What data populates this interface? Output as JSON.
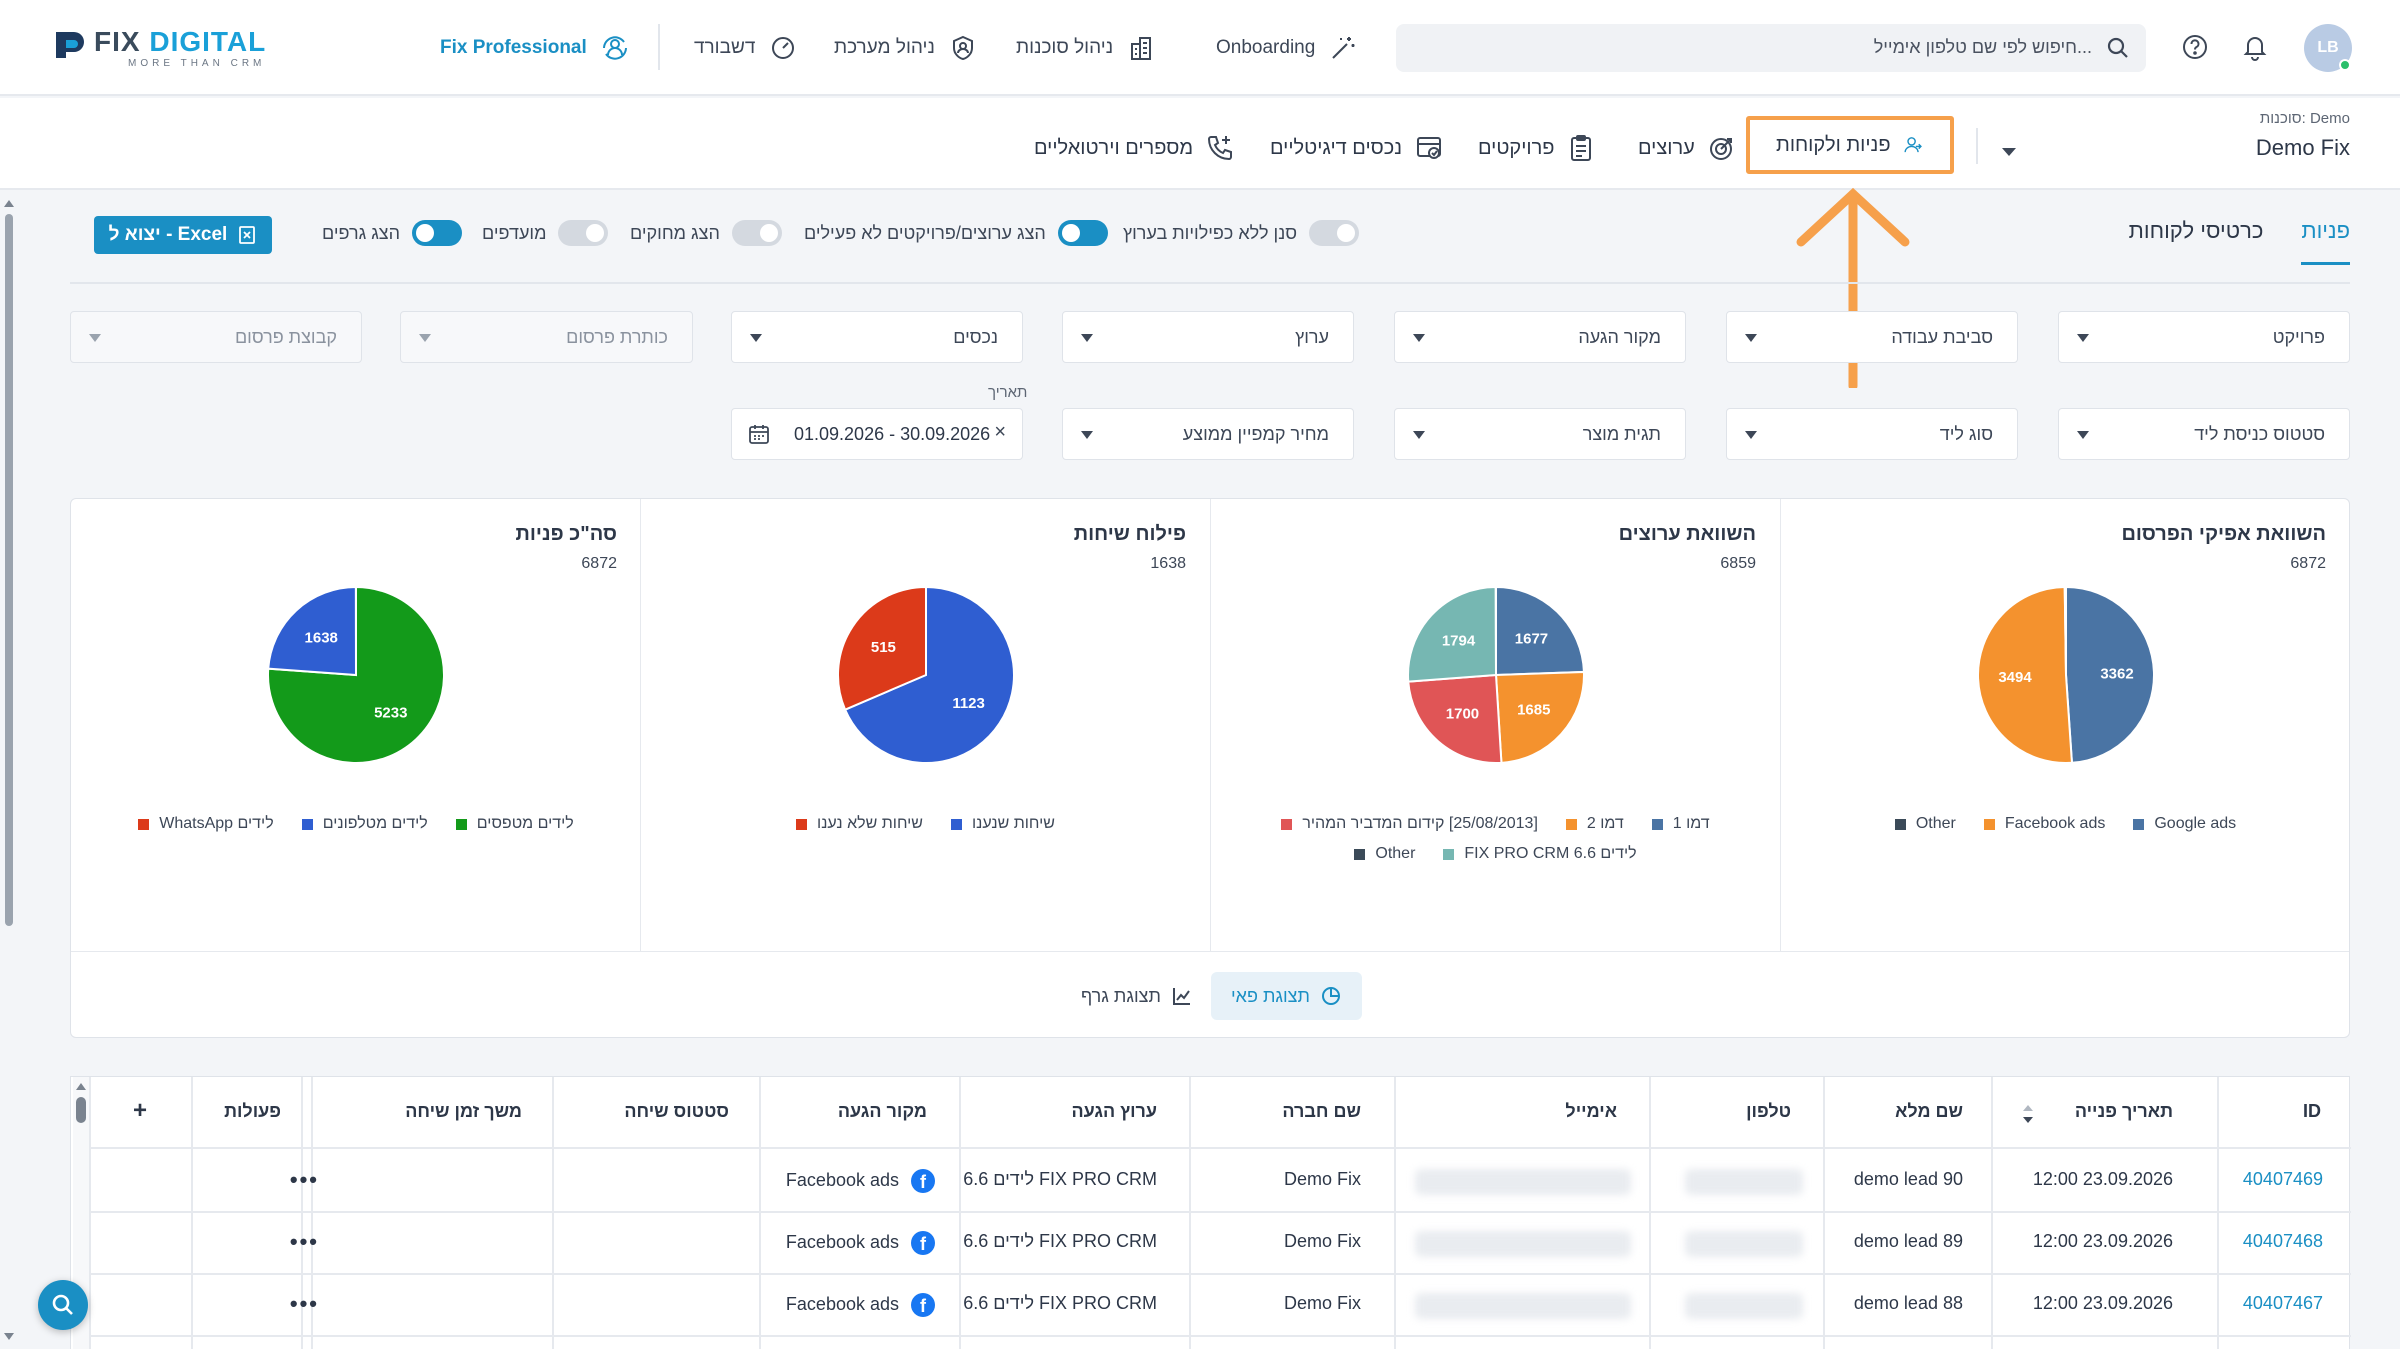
{
  "brand": {
    "word_a": "FIX ",
    "word_b": "DIGITAL",
    "tagline": "MORE THAN CRM"
  },
  "topnav": {
    "pro": "Fix Professional",
    "items": [
      "דשבורד",
      "ניהול מערכת",
      "ניהול סוכנות",
      "Onboarding"
    ],
    "search_placeholder": "חיפוש לפי שם טלפון אימייל...",
    "avatar": "LB"
  },
  "agency": {
    "label": "סוכנות: Demo",
    "value": "Demo Fix"
  },
  "modules": [
    "פניות ולקוחות",
    "ערוצים",
    "פרויקטים",
    "נכסים דיגיטליים",
    "מספרים וירטואליים"
  ],
  "tabs": [
    "פניות",
    "כרטיסי לקוחות"
  ],
  "toggles": [
    {
      "label": "סנן ללא כפילויות בערוץ",
      "on": false
    },
    {
      "label": "הצג ערוצים/פרויקטים לא פעילים",
      "on": true
    },
    {
      "label": "הצג מחוקים",
      "on": false
    },
    {
      "label": "מועדפים",
      "on": false
    },
    {
      "label": "הצג גרפים",
      "on": true
    }
  ],
  "export_label": "יצוא ל - Excel",
  "filters": {
    "row1": [
      "פרויקט",
      "סביבת עבודה",
      "מקור הגעה",
      "ערוץ",
      "נכסים",
      "כותרת פרסום",
      "קבוצת פרסום"
    ],
    "row2": [
      "סטטוס כניסת ליד",
      "סוג ליד",
      "תגית מוצר",
      "מחיר קמפיין ממוצע"
    ],
    "date_label": "תאריך",
    "date_value": "01.09.2026 - 30.09.2026",
    "date_clear": "×"
  },
  "charts": [
    {
      "title": "השוואת אפיקי הפרסום",
      "total": "6872",
      "slices": [
        {
          "label": "Google ads",
          "value": 3362,
          "color": "#4a74a4"
        },
        {
          "label": "Facebook ads",
          "value": 3494,
          "color": "#f4922e"
        },
        {
          "label": "Other",
          "value": 16,
          "color": "#3b4a58"
        }
      ],
      "slice_labels": [
        "3362",
        "3494"
      ],
      "legend": [
        "Google ads",
        "Facebook ads",
        "Other"
      ]
    },
    {
      "title": "השוואת ערוצים",
      "total": "6859",
      "slices": [
        {
          "label": "דמו 1",
          "value": 1677,
          "color": "#4a74a4"
        },
        {
          "label": "דמו 2",
          "value": 1685,
          "color": "#f4922e"
        },
        {
          "label": "[25/08/2013] קידום המדביר המהיר",
          "value": 1700,
          "color": "#e05556"
        },
        {
          "label": "לידים FIX PRO CRM 6.6",
          "value": 1794,
          "color": "#76b7b2"
        },
        {
          "label": "Other",
          "value": 3,
          "color": "#3b4a58"
        }
      ],
      "slice_labels": [
        "1677",
        "1685",
        "1700",
        "1794"
      ],
      "legend": [
        "דמו 1",
        "דמו 2",
        "[25/08/2013] קידום המדביר המהיר",
        "לידים FIX PRO CRM 6.6",
        "Other"
      ]
    },
    {
      "title": "פילוח שיחות",
      "total": "1638",
      "slices": [
        {
          "label": "שיחות שנענו",
          "value": 1123,
          "color": "#2f5ed1"
        },
        {
          "label": "שיחות שלא נענו",
          "value": 515,
          "color": "#dc3a1a"
        }
      ],
      "slice_labels": [
        "1123",
        "515"
      ],
      "legend": [
        "שיחות שנענו",
        "שיחות שלא נענו"
      ]
    },
    {
      "title": "סה\"כ פניות",
      "total": "6872",
      "slices": [
        {
          "label": "לידים מטפסים",
          "value": 5233,
          "color": "#139a1a"
        },
        {
          "label": "לידים מטלפונים",
          "value": 1638,
          "color": "#2f5ed1"
        },
        {
          "label": "לידים WhatsApp",
          "value": 1,
          "color": "#dc3a1a"
        }
      ],
      "slice_labels": [
        "5233",
        "1638"
      ],
      "legend": [
        "לידים מטפסים",
        "לידים מטלפונים",
        "לידים WhatsApp"
      ]
    }
  ],
  "view_buttons": {
    "pie": "תצוגת פאי",
    "graph": "תצוגת גרף"
  },
  "table": {
    "headers": [
      "ID",
      "תאריך פנייה",
      "שם מלא",
      "טלפון",
      "אימייל",
      "שם חברה",
      "ערוץ הגעה",
      "מקור הגעה",
      "סטטוס שיחה",
      "משך זמן שיחה",
      "פעולות",
      "+"
    ],
    "rows": [
      {
        "id": "40407469",
        "date": "12:00 23.09.2026",
        "name": "demo lead 90",
        "company": "Demo Fix",
        "channel": "6.6 לידים FIX PRO CRM",
        "source": "Facebook ads",
        "actions": "•••"
      },
      {
        "id": "40407468",
        "date": "12:00 23.09.2026",
        "name": "demo lead 89",
        "company": "Demo Fix",
        "channel": "6.6 לידים FIX PRO CRM",
        "source": "Facebook ads",
        "actions": "•••"
      },
      {
        "id": "40407467",
        "date": "12:00 23.09.2026",
        "name": "demo lead 88",
        "company": "Demo Fix",
        "channel": "6.6 לידים FIX PRO CRM",
        "source": "Facebook ads",
        "actions": "•••"
      }
    ]
  },
  "colors": {
    "accent": "#1a8fc4",
    "highlight": "#f6a04b"
  }
}
